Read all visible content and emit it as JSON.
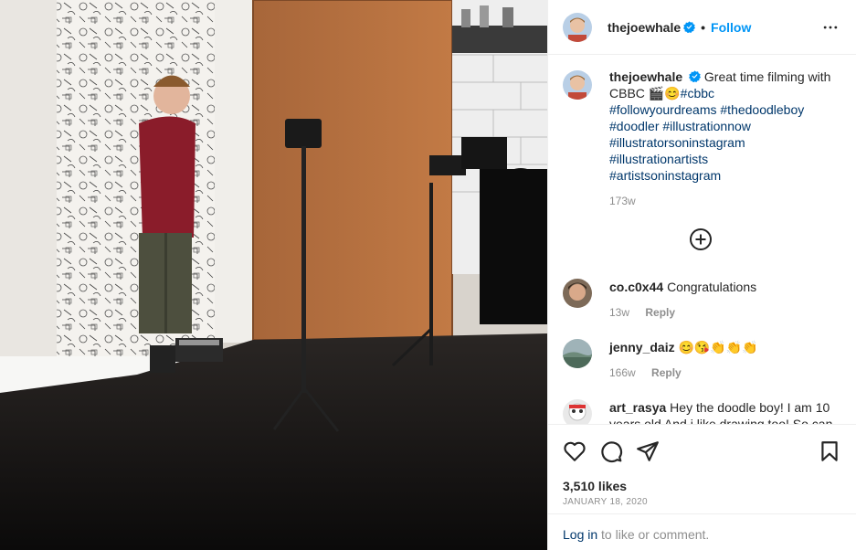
{
  "post": {
    "username": "thejoewhale",
    "follow_label": "Follow",
    "dot": "•",
    "caption_text": "Great time filming with CBBC 🎬😊",
    "hashtags": [
      "#cbbc",
      "#followyourdreams",
      "#thedoodleboy",
      "#doodler",
      "#illustrationnow",
      "#illustratorsoninstagram",
      "#illustrationartists",
      "#artistsoninstagram"
    ],
    "caption_age": "173w",
    "likes": "3,510 likes",
    "date": "JANUARY 18, 2020"
  },
  "comments": [
    {
      "username": "co.c0x44",
      "text": "Congratulations",
      "age": "13w",
      "reply_label": "Reply"
    },
    {
      "username": "jenny_daiz",
      "text": "😊😘👏👏👏",
      "age": "166w",
      "reply_label": "Reply"
    },
    {
      "username": "art_rasya",
      "text": "Hey the doodle boy! I am 10 years old And i like drawing too! So can",
      "age": "",
      "reply_label": ""
    }
  ],
  "footer": {
    "login_label": "Log in",
    "login_suffix": " to like or comment."
  },
  "icons": {
    "verified": "verified-badge-icon",
    "more": "more-options-icon",
    "load_more": "load-more-comments-icon",
    "like": "heart-icon",
    "comment": "comment-icon",
    "share": "share-icon",
    "save": "bookmark-icon"
  },
  "colors": {
    "accent": "#0095f6",
    "link": "#00376b",
    "muted": "#8e8e8e",
    "text": "#262626",
    "border": "#efefef"
  }
}
